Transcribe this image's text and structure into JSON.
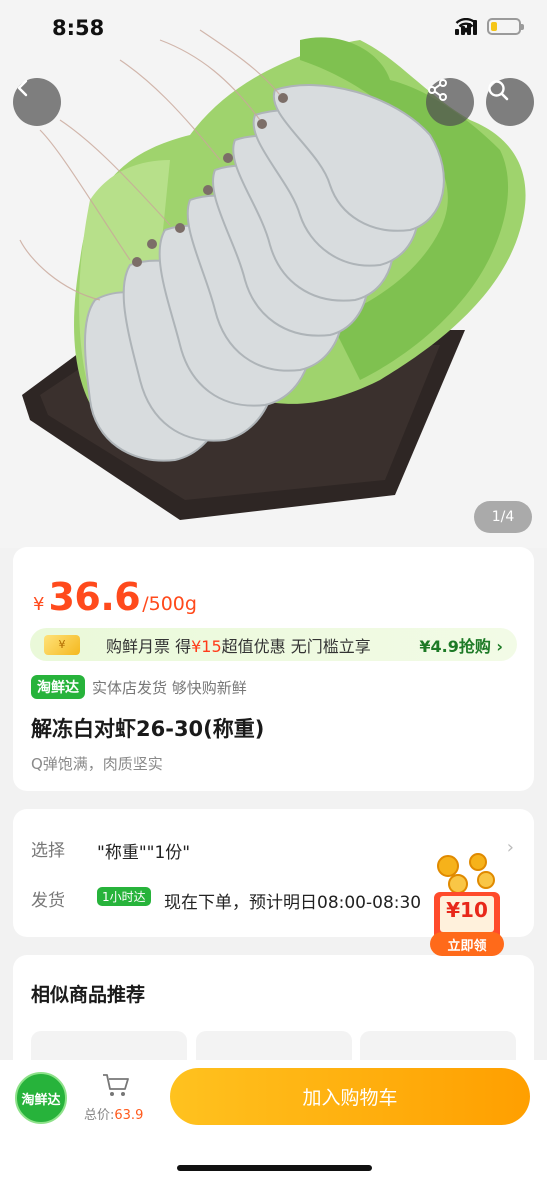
{
  "status_bar": {
    "time": "8:58"
  },
  "hero": {
    "pager": "1/4"
  },
  "product": {
    "currency": "¥",
    "price": "36.6",
    "unit": "/500g",
    "coupon": {
      "icon": "¥",
      "text_before": "购鲜月票 得",
      "text_highlight": "¥15",
      "text_after": "超值优惠 无门槛立享",
      "action": "¥4.9抢购 ›"
    },
    "tag": "淘鲜达",
    "tag_desc": "实体店发货 够快购新鲜",
    "title": "解冻白对虾26-30(称重)",
    "subtitle": "Q弹饱满，肉质坚实"
  },
  "options": {
    "select_label": "选择",
    "select_value": "\"称重\"\"1份\"",
    "ship_label": "发货",
    "ship_tag": "1小时达",
    "ship_value": "现在下单，预计明日08:00-08:30"
  },
  "float_coupon": {
    "amount": "¥10",
    "action": "立即领"
  },
  "recommend": {
    "title": "相似商品推荐"
  },
  "bottom_bar": {
    "brand": "淘鲜达",
    "total_label": "总价:",
    "total_value": "63.9",
    "add_to_cart": "加入购物车"
  },
  "colors": {
    "price_red": "#ff4a1c",
    "brand_green": "#27b33b",
    "cart_orange": "#ffa800"
  }
}
